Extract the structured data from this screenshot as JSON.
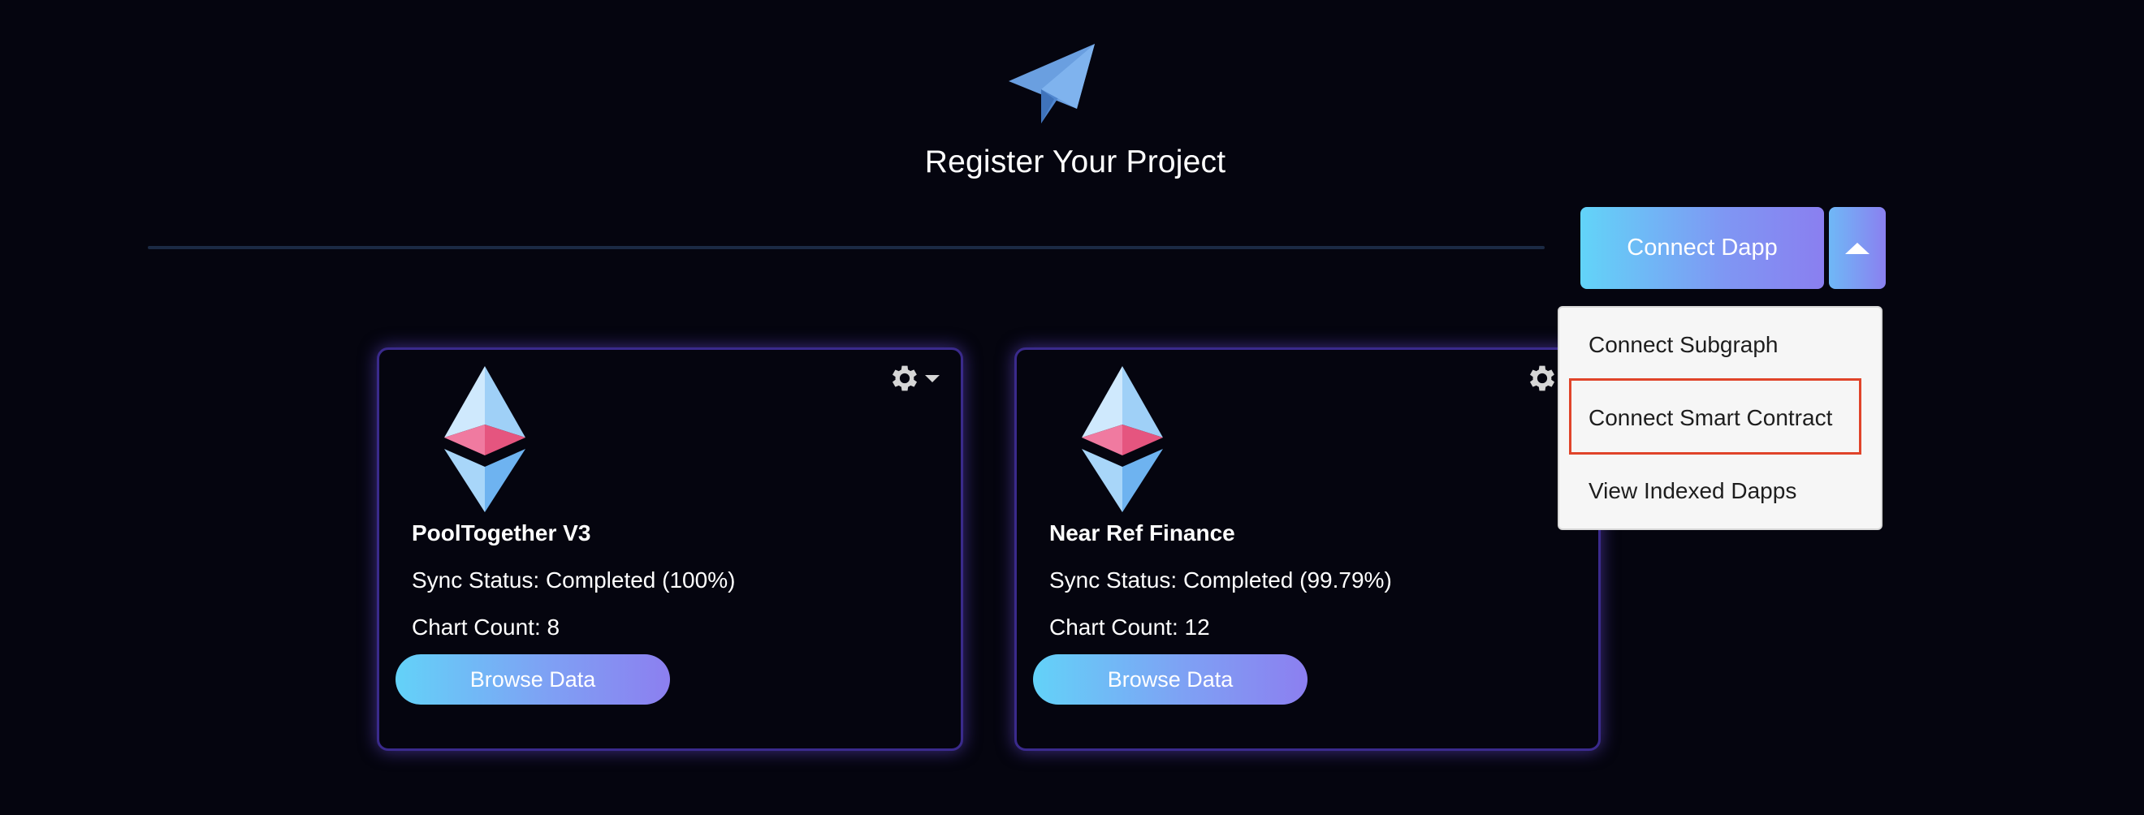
{
  "header": {
    "title": "Register Your Project",
    "logo_icon": "paper-plane-icon"
  },
  "connect": {
    "button_label": "Connect Dapp",
    "toggle_icon": "caret-up-icon",
    "menu": [
      {
        "label": "Connect Subgraph"
      },
      {
        "label": "Connect Smart Contract",
        "highlighted": true
      },
      {
        "label": "View Indexed Dapps"
      }
    ]
  },
  "projects": [
    {
      "name": "PoolTogether V3",
      "sync_status": "Sync Status: Completed (100%)",
      "chart_count": "Chart Count: 8",
      "browse_label": "Browse Data",
      "icon": "ethereum-icon"
    },
    {
      "name": "Near Ref Finance",
      "sync_status": "Sync Status: Completed (99.79%)",
      "chart_count": "Chart Count: 12",
      "browse_label": "Browse Data",
      "icon": "ethereum-icon"
    }
  ],
  "colors": {
    "background": "#05050f",
    "accent_gradient_start": "#62d4f8",
    "accent_gradient_end": "#8a7ff0",
    "card_border": "#3a2a8c",
    "highlight": "#e0442a"
  }
}
